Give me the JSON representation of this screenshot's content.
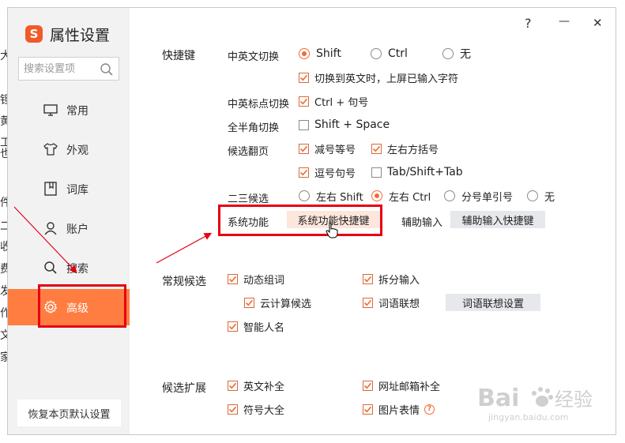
{
  "background_fragments": [
    "大",
    "钽",
    "黄",
    "工也",
    "件",
    "二",
    "收",
    "费",
    "发",
    "作",
    "文",
    "家"
  ],
  "window": {
    "help": "?",
    "minimize": "—",
    "close": "✕"
  },
  "sidebar": {
    "app_title": "属性设置",
    "logo_letter": "S",
    "search_placeholder": "搜索设置项",
    "items": [
      {
        "label": "常用",
        "icon": "monitor-icon",
        "active": false
      },
      {
        "label": "外观",
        "icon": "shirt-icon",
        "active": false
      },
      {
        "label": "词库",
        "icon": "book-icon",
        "active": false
      },
      {
        "label": "账户",
        "icon": "user-icon",
        "active": false
      },
      {
        "label": "搜索",
        "icon": "search-icon",
        "active": false
      },
      {
        "label": "高级",
        "icon": "gear-icon",
        "active": true
      }
    ],
    "reset_label": "恢复本页默认设置"
  },
  "shortcuts": {
    "section_label": "快捷键",
    "cn_en_switch": {
      "label": "中英文切换",
      "options": [
        "Shift",
        "Ctrl",
        "无"
      ],
      "selected": "Shift"
    },
    "commit_on_switch": {
      "label": "切换到英文时，上屏已输入字符",
      "checked": true
    },
    "punct_switch": {
      "label": "中英标点切换",
      "option": "Ctrl + 句号",
      "checked": true
    },
    "width_switch": {
      "label": "全半角切换",
      "option": "Shift + Space",
      "checked": false
    },
    "page_turn": {
      "label": "候选翻页",
      "options": [
        {
          "label": "减号等号",
          "checked": true
        },
        {
          "label": "左右方括号",
          "checked": true
        },
        {
          "label": "逗号句号",
          "checked": true
        },
        {
          "label": "Tab/Shift+Tab",
          "checked": false
        }
      ]
    },
    "second_third": {
      "label": "二三候选",
      "options": [
        "左右 Shift",
        "左右 Ctrl",
        "分号单引号",
        "无"
      ],
      "selected": "左右 Ctrl"
    },
    "system_function": {
      "label": "系统功能",
      "button": "系统功能快捷键"
    },
    "aux_input": {
      "label": "辅助输入",
      "button": "辅助输入快捷键"
    }
  },
  "regular_candidates": {
    "section_label": "常规候选",
    "options": [
      {
        "label": "动态组词",
        "checked": true
      },
      {
        "label": "拆分输入",
        "checked": true
      },
      {
        "label": "云计算候选",
        "checked": true
      },
      {
        "label": "词语联想",
        "checked": true
      },
      {
        "label": "智能人名",
        "checked": true
      }
    ],
    "assoc_button": "词语联想设置"
  },
  "candidate_ext": {
    "section_label": "候选扩展",
    "options": [
      {
        "label": "英文补全",
        "checked": true
      },
      {
        "label": "网址邮箱补全",
        "checked": true
      },
      {
        "label": "符号大全",
        "checked": true
      },
      {
        "label": "图片表情",
        "checked": true
      }
    ]
  },
  "watermark": {
    "brand": "Bai",
    "brand2": "经验",
    "url": "jingyan.baidu.com"
  },
  "colors": {
    "accent": "#ff7d41",
    "highlight": "#e60012",
    "checkbox": "#ef6b35"
  }
}
